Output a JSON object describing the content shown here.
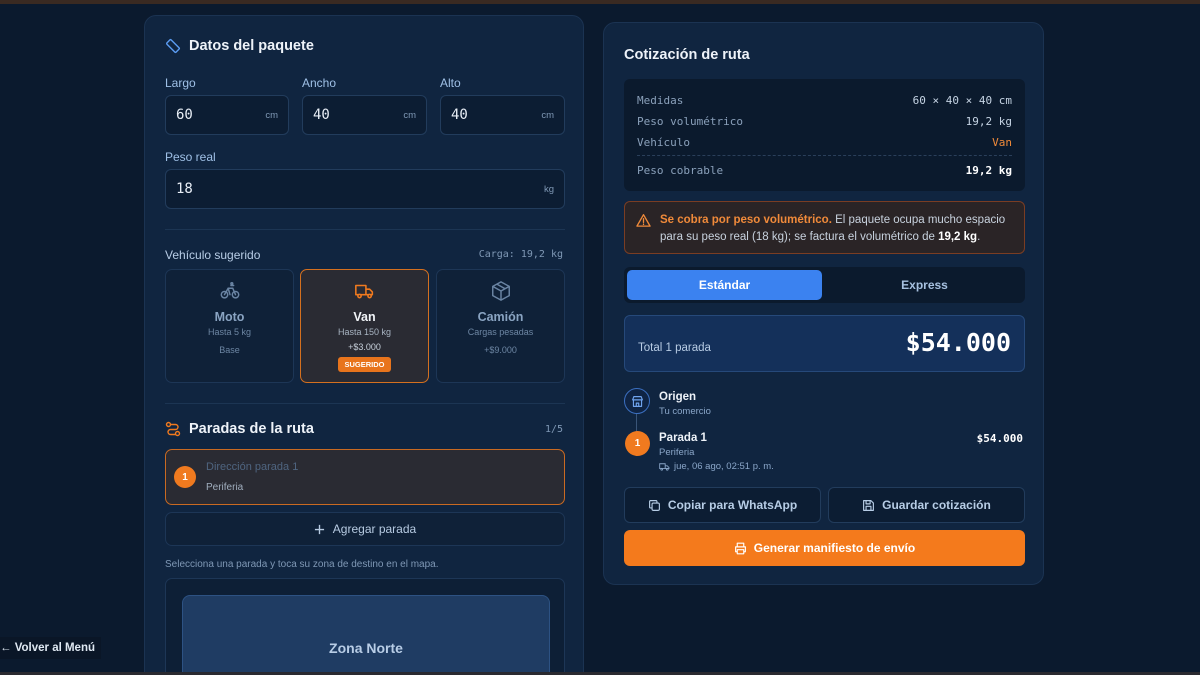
{
  "package": {
    "title": "Datos del paquete",
    "largo": {
      "label": "Largo",
      "value": "60",
      "unit": "cm"
    },
    "ancho": {
      "label": "Ancho",
      "value": "40",
      "unit": "cm"
    },
    "alto": {
      "label": "Alto",
      "value": "40",
      "unit": "cm"
    },
    "peso": {
      "label": "Peso real",
      "value": "18",
      "unit": "kg"
    }
  },
  "vehicles": {
    "title": "Vehículo sugerido",
    "load": "Carga: 19,2 kg",
    "items": [
      {
        "name": "Moto",
        "capacity": "Hasta 5 kg",
        "price": "Base",
        "icon": "bicycle-icon"
      },
      {
        "name": "Van",
        "capacity": "Hasta 150 kg",
        "price": "+$3.000",
        "badge": "SUGERIDO",
        "icon": "truck-icon",
        "selected": true
      },
      {
        "name": "Camión",
        "capacity": "Cargas pesadas",
        "price": "+$9.000",
        "icon": "box-icon"
      }
    ]
  },
  "stops": {
    "title": "Paradas de la ruta",
    "count": "1/5",
    "items": [
      {
        "number": "1",
        "placeholder": "Dirección parada 1",
        "zone": "Periferia"
      }
    ],
    "add_label": "Agregar parada",
    "hint": "Selecciona una parada y toca su zona de destino en el mapa."
  },
  "map": {
    "zone_label": "Zona Norte"
  },
  "quote": {
    "title": "Cotización de ruta",
    "summary": {
      "medidas_label": "Medidas",
      "medidas_value": "60 × 40 × 40 cm",
      "volumetric_label": "Peso volumétrico",
      "volumetric_value": "19,2 kg",
      "vehicle_label": "Vehículo",
      "vehicle_value": "Van",
      "chargeable_label": "Peso cobrable",
      "chargeable_value": "19,2 kg"
    },
    "alert": {
      "strong": "Se cobra por peso volumétrico.",
      "text1": " El paquete ocupa mucho espacio para su peso real (18 kg); se factura el volumétrico de ",
      "value": "19,2 kg",
      "text2": "."
    },
    "tabs": [
      "Estándar",
      "Express"
    ],
    "total_label": "Total 1 parada",
    "total_value": "$54.000",
    "timeline": {
      "origin_title": "Origen",
      "origin_sub": "Tu comercio",
      "stop_number": "1",
      "stop_title": "Parada 1",
      "stop_zone": "Periferia",
      "stop_date": "jue, 06 ago, 02:51 p. m.",
      "stop_price": "$54.000"
    },
    "copy_label": "Copiar para WhatsApp",
    "save_label": "Guardar cotización",
    "manifest_label": "Generar manifiesto de envío"
  },
  "nav": {
    "back_label": "← Volver al Menú"
  },
  "colors": {
    "accent_blue": "#3b82f0",
    "accent_orange": "#f47a1c",
    "background": "#0b1a2e"
  }
}
